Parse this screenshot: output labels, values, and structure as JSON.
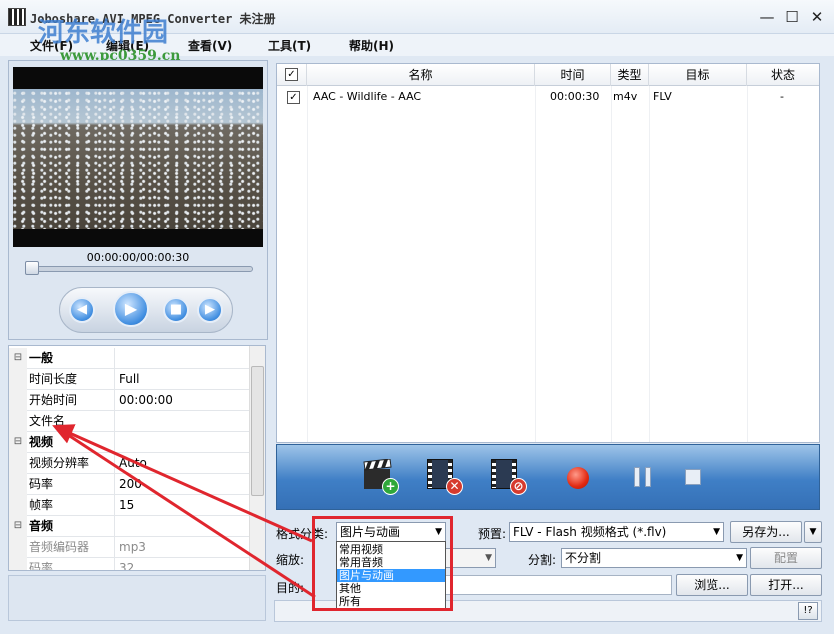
{
  "window": {
    "title": "Joboshare AVI MPEG Converter 未注册",
    "min_icon": "—",
    "max_icon": "☐",
    "close_icon": "✕"
  },
  "watermark": {
    "text": "河东软件园",
    "url": "www.pc0359.cn"
  },
  "menu": [
    {
      "label": "文件(F)"
    },
    {
      "label": "编辑(E)"
    },
    {
      "label": "查看(V)"
    },
    {
      "label": "工具(T)"
    },
    {
      "label": "帮助(H)"
    }
  ],
  "player": {
    "time": "00:00:00/00:00:30",
    "seek_fraction": 0.0,
    "buttons": {
      "prev": "◀",
      "play": "▶",
      "stop": "■",
      "next": "▶"
    }
  },
  "properties": [
    {
      "kind": "cat",
      "gutter": "⊟",
      "name": "一般",
      "value": ""
    },
    {
      "kind": "row",
      "name": "时间长度",
      "value": "Full"
    },
    {
      "kind": "row",
      "name": "开始时间",
      "value": "00:00:00"
    },
    {
      "kind": "row",
      "name": "文件名",
      "value": ""
    },
    {
      "kind": "cat",
      "gutter": "⊟",
      "name": "视频",
      "value": ""
    },
    {
      "kind": "row",
      "name": "视频分辨率",
      "value": "Auto"
    },
    {
      "kind": "row",
      "name": "码率",
      "value": "200"
    },
    {
      "kind": "row",
      "name": "帧率",
      "value": "15"
    },
    {
      "kind": "cat",
      "gutter": "⊟",
      "name": "音频",
      "value": ""
    },
    {
      "kind": "dim",
      "name": "音频编码器",
      "value": "mp3"
    },
    {
      "kind": "dim",
      "name": "码率",
      "value": "32"
    }
  ],
  "filelist": {
    "headers": {
      "check": "✓",
      "name": "名称",
      "time": "时间",
      "type": "类型",
      "target": "目标",
      "status": "状态"
    },
    "rows": [
      {
        "checked": "✓",
        "name": "AAC - Wildlife - AAC",
        "time": "00:00:30",
        "type": "m4v",
        "target": "FLV",
        "status": "-"
      }
    ]
  },
  "toolbar_icons": [
    "add-file-icon",
    "remove-file-icon",
    "clear-list-icon",
    "record-icon",
    "pause-icon",
    "stop-icon"
  ],
  "toolbar_badges": {
    "add": "+",
    "remove": "✕",
    "clear": "⊘"
  },
  "format": {
    "category_label": "格式分类:",
    "category_value": "图片与动画",
    "preset_label": "预置:",
    "preset_value": "FLV - Flash 视频格式 (*.flv)",
    "save_as": "另存为...",
    "scale_label": "缩放:",
    "split_label": "分割:",
    "split_value": "不分割",
    "config": "配置",
    "dest_label": "目的:",
    "browse": "浏览...",
    "open": "打开...",
    "help": "!?"
  },
  "dropdown": {
    "options": [
      "常用视频",
      "常用音频",
      "图片与动画",
      "其他",
      "所有"
    ],
    "selected_index": 2
  },
  "colors": {
    "accent_blue": "#3f7fc6",
    "highlight_red": "#e0262e",
    "selection": "#3399ff"
  }
}
